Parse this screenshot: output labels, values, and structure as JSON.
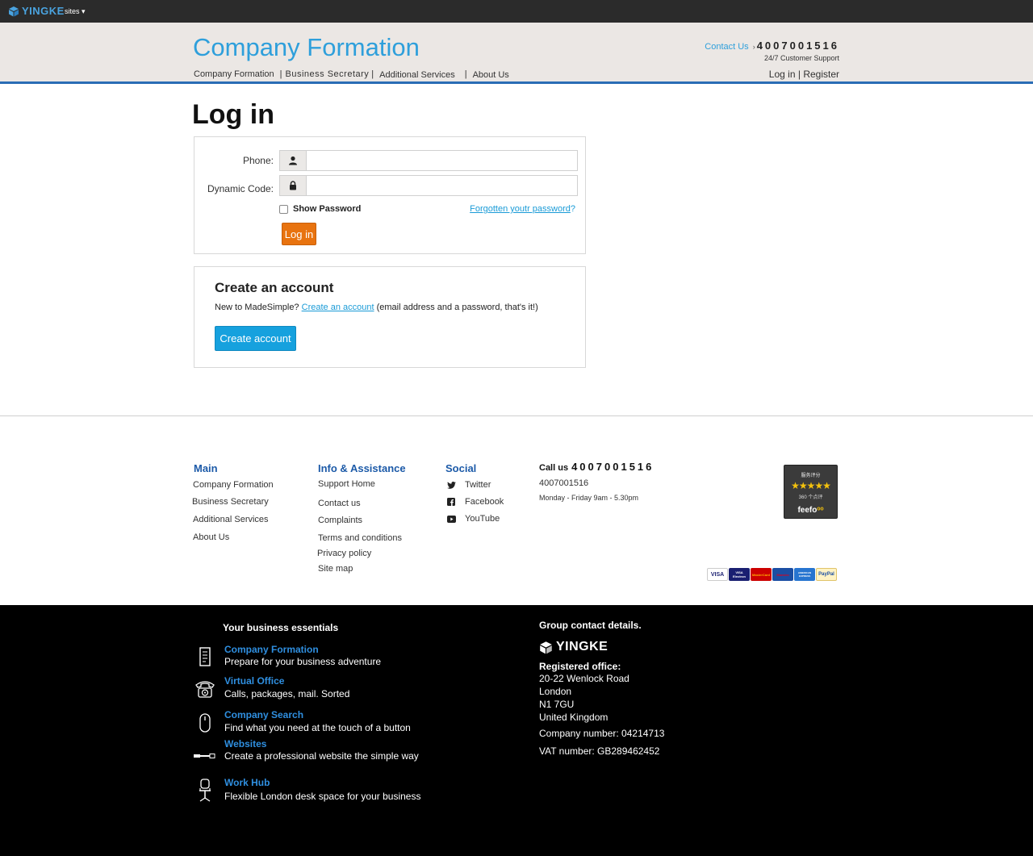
{
  "topbar": {
    "logo": "YINGKE",
    "sites": "sites ▾"
  },
  "header": {
    "brand": "Company Formation",
    "nav": [
      "Company Formation",
      "|",
      "Business Secretary",
      "|",
      "Additional Services",
      "|",
      "About Us"
    ],
    "contact_label": "Contact Us",
    "phone": "4007001516",
    "support": "24/7 Customer Support",
    "login": "Log in",
    "sep": "|",
    "register": "Register"
  },
  "login": {
    "title": "Log in",
    "phone_label": "Phone:",
    "code_label": "Dynamic Code:",
    "show_password": "Show Password",
    "forgot": "Forgotten youtr password",
    "forgot_q": "?",
    "button": "Log in"
  },
  "create": {
    "title": "Create an account",
    "text_before": "New to MadeSimple?",
    "link": "Create an account",
    "text_after": "(email address and a password, that's it!)",
    "button": "Create account"
  },
  "footer": {
    "main_title": "Main",
    "main_links": [
      "Company Formation",
      "Business Secretary",
      "Additional Services",
      "About Us"
    ],
    "info_title": "Info & Assistance",
    "info_links": [
      "Support Home",
      "Contact us",
      "Complaints",
      "Terms and conditions",
      "Privacy policy",
      "Site map"
    ],
    "social_title": "Social",
    "social_links": [
      "Twitter",
      "Facebook",
      "YouTube"
    ],
    "call_label": "Call us",
    "call_number": "4007001516",
    "call_number_plain": "4007001516",
    "hours": "Monday - Friday 9am - 5.30pm",
    "feefo": {
      "top": "服务评分",
      "stars": "★★★★★",
      "count": "360 个点评",
      "brand": "feefo"
    },
    "cards": [
      "VISA",
      "VISA Electron",
      "MasterCard",
      "Maestro",
      "AMERICAN EXPRESS",
      "PayPal"
    ]
  },
  "dark": {
    "title": "Your business essentials",
    "items": [
      {
        "name": "Company Formation",
        "desc": "Prepare for your business adventure"
      },
      {
        "name": "Virtual Office",
        "desc": "Calls, packages, mail. Sorted"
      },
      {
        "name": "Company Search",
        "desc": "Find what you need at the touch of a button"
      },
      {
        "name": "Websites",
        "desc": "Create a professional website the simple way"
      },
      {
        "name": "Work Hub",
        "desc": "Flexible London desk space for your business"
      }
    ],
    "group_title": "Group contact details.",
    "group_logo": "YINGKE",
    "registered": "Registered office:",
    "address": [
      "20-22 Wenlock Road",
      "London",
      "N1 7GU",
      "United Kingdom"
    ],
    "company_number": "Company number: 04214713",
    "vat": "VAT number: GB289462452"
  },
  "colors": {
    "accent": "#2e9fdb",
    "nav_rule": "#2a6db5",
    "login_btn": "#e8730f",
    "create_btn": "#16a1de",
    "footer_heading": "#1c5aa8"
  }
}
